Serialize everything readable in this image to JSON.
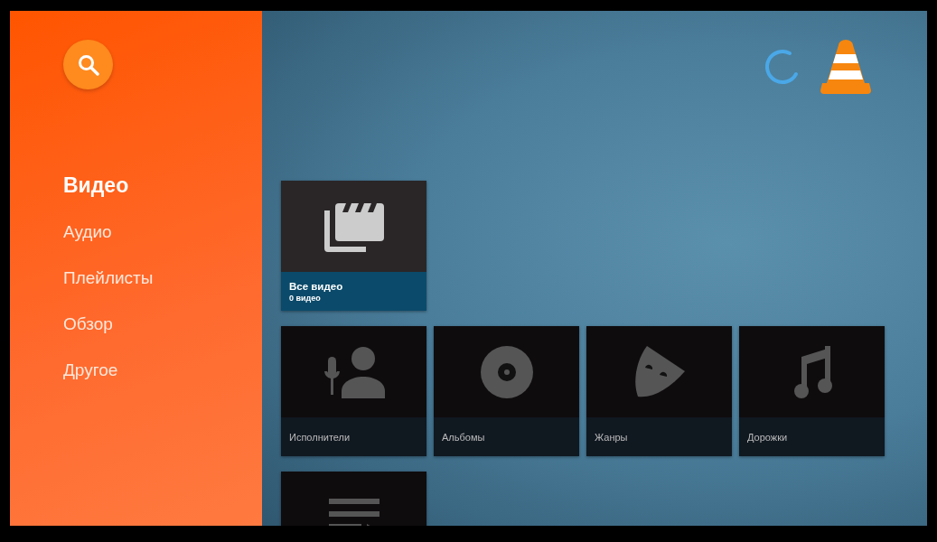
{
  "sidebar": {
    "items": [
      {
        "label": "Видео",
        "selected": true
      },
      {
        "label": "Аудио",
        "selected": false
      },
      {
        "label": "Плейлисты",
        "selected": false
      },
      {
        "label": "Обзор",
        "selected": false
      },
      {
        "label": "Другое",
        "selected": false
      }
    ]
  },
  "rows": [
    {
      "cards": [
        {
          "kind": "video",
          "title": "Все видео",
          "subtitle": "0 видео",
          "selected": true
        }
      ]
    },
    {
      "cards": [
        {
          "kind": "artist",
          "title": "Исполнители",
          "selected": false
        },
        {
          "kind": "album",
          "title": "Альбомы",
          "selected": false
        },
        {
          "kind": "genre",
          "title": "Жанры",
          "selected": false
        },
        {
          "kind": "track",
          "title": "Дорожки",
          "selected": false
        }
      ]
    },
    {
      "cards": [
        {
          "kind": "playlist",
          "selected": false
        }
      ]
    }
  ]
}
